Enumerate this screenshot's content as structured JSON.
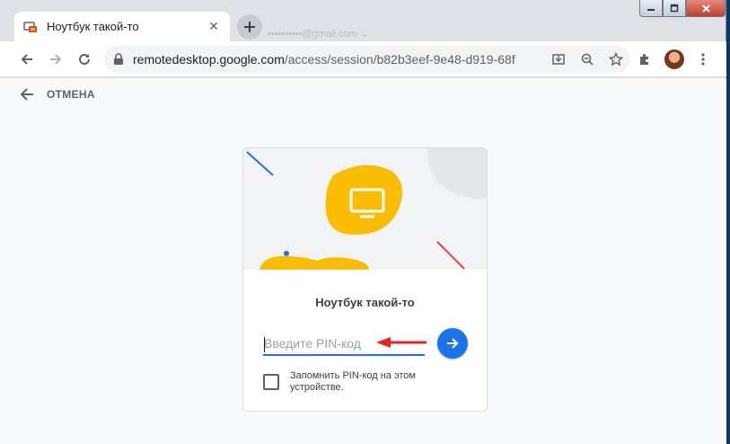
{
  "browser": {
    "tab_title": "Ноутбук такой-то",
    "ghost_email": "••••••••••@gmail.com ⌄",
    "url_host": "remotedesktop.google.com",
    "url_path": "/access/session/b82b3eef-9e48-d919-68f"
  },
  "icons": {
    "back": "arrow-left-icon",
    "forward": "arrow-right-icon",
    "reload": "reload-icon",
    "lock": "lock-icon",
    "install": "install-app-icon",
    "zoom": "zoom-icon",
    "bookmark": "star-icon",
    "extensions": "puzzle-icon",
    "menu": "kebab-menu-icon"
  },
  "page": {
    "cancel_label": "ОТМЕНА",
    "card_title": "Ноутбук такой-то",
    "pin_placeholder": "Введите PIN-код",
    "remember_label": "Запомнить PIN-код на этом устройстве."
  },
  "colors": {
    "accent": "#1a73e8",
    "hero_yellow": "#fbbc04",
    "annotation_red": "#e8231a"
  }
}
